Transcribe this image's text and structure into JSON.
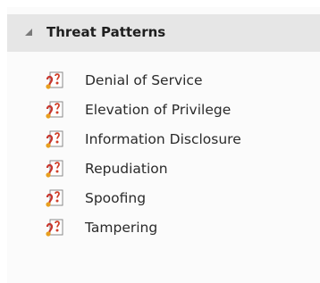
{
  "group": {
    "title": "Threat Patterns",
    "icon": "collapse-triangle-icon",
    "expanded": true
  },
  "items": [
    {
      "label": "Denial of Service",
      "icon": "threat-pattern-icon"
    },
    {
      "label": "Elevation of Privilege",
      "icon": "threat-pattern-icon"
    },
    {
      "label": "Information Disclosure",
      "icon": "threat-pattern-icon"
    },
    {
      "label": "Repudiation",
      "icon": "threat-pattern-icon"
    },
    {
      "label": "Spoofing",
      "icon": "threat-pattern-icon"
    },
    {
      "label": "Tampering",
      "icon": "threat-pattern-icon"
    }
  ],
  "colors": {
    "header_background": "#e6e6e6",
    "panel_background": "#fbfbfb",
    "icon_red": "#c8362e",
    "icon_orange": "#e8a020"
  }
}
